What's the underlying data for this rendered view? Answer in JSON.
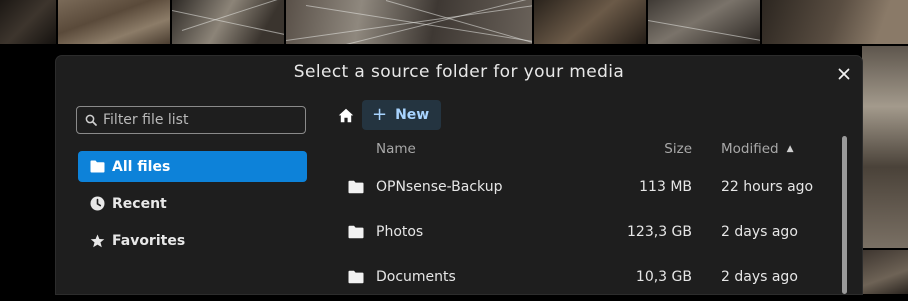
{
  "dialog": {
    "title": "Select a source folder for your media",
    "close_icon": "close-icon"
  },
  "sidebar": {
    "filter_placeholder": "Filter file list",
    "items": [
      {
        "label": "All files",
        "icon": "folder-icon",
        "active": true
      },
      {
        "label": "Recent",
        "icon": "clock-icon",
        "active": false
      },
      {
        "label": "Favorites",
        "icon": "star-icon",
        "active": false
      }
    ]
  },
  "toolbar": {
    "home_icon": "home-icon",
    "new_label": "New"
  },
  "table": {
    "headers": {
      "name": "Name",
      "size": "Size",
      "modified": "Modified"
    },
    "sort": {
      "column": "modified",
      "direction": "ascending"
    },
    "rows": [
      {
        "name": "OPNsense-Backup",
        "size": "113 MB",
        "modified": "22 hours ago"
      },
      {
        "name": "Photos",
        "size": "123,3 GB",
        "modified": "2 days ago"
      },
      {
        "name": "Documents",
        "size": "10,3 GB",
        "modified": "2 days ago"
      }
    ]
  },
  "colors": {
    "accent": "#0d82d9",
    "dialog_bg": "#1e1e1e",
    "new_button_text": "#a8d4ff"
  }
}
